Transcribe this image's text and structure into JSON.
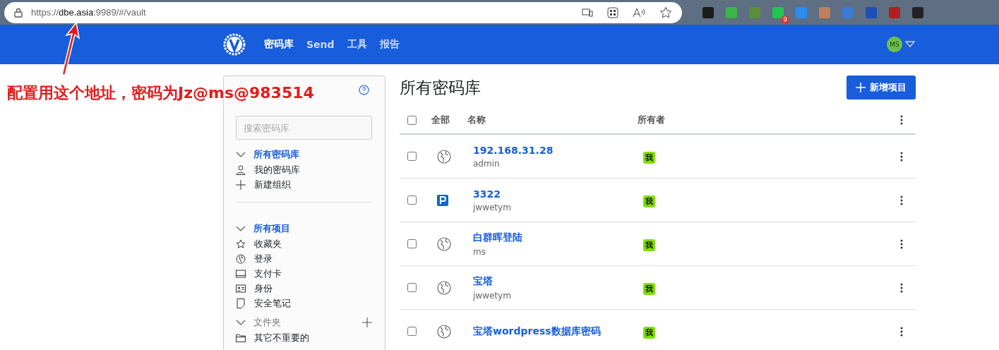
{
  "browser": {
    "url_scheme": "https://",
    "url_host": "dbe.asia",
    "url_rest": ":9989/#/vault",
    "extension_badge": "9"
  },
  "nav": {
    "items": [
      {
        "label": "密码库",
        "selected": true
      },
      {
        "label": "Send",
        "selected": false
      },
      {
        "label": "工具",
        "selected": false
      },
      {
        "label": "报告",
        "selected": false
      }
    ],
    "avatar": "MS"
  },
  "annotation": {
    "text": "配置用这个地址，密码为Jz@ms@983514"
  },
  "sidebar": {
    "search_placeholder": "搜索密码库",
    "sections": [
      {
        "kind": "filter",
        "title": "所有密码库",
        "expanded": true,
        "items": [
          {
            "kind": "user",
            "label": "我的密码库"
          },
          {
            "kind": "plus",
            "label": "新建组织"
          }
        ]
      },
      {
        "kind": "filter",
        "title": "所有项目",
        "expanded": true,
        "items": [
          {
            "kind": "star",
            "label": "收藏夹"
          },
          {
            "kind": "globe",
            "label": "登录"
          },
          {
            "kind": "card",
            "label": "支付卡"
          },
          {
            "kind": "id",
            "label": "身份"
          },
          {
            "kind": "note",
            "label": "安全笔记"
          }
        ]
      },
      {
        "kind": "folders",
        "title": "文件夹",
        "expanded": true,
        "items": [
          {
            "kind": "folder",
            "label": "其它不重要的"
          }
        ]
      }
    ]
  },
  "main": {
    "title": "所有密码库",
    "add_button": "新增项目",
    "columns": [
      "全部",
      "名称",
      "所有者"
    ],
    "select_all_checked": false,
    "rows": [
      {
        "kind": "globe",
        "name": "192.168.31.28",
        "username": "admin",
        "owner": "我",
        "checked": false
      },
      {
        "kind": "p",
        "name": "3322",
        "username": "jwwetym",
        "owner": "我",
        "checked": false
      },
      {
        "kind": "globe",
        "name": "白群晖登陆",
        "username": "ms",
        "owner": "我",
        "checked": false
      },
      {
        "kind": "globe",
        "name": "宝塔",
        "username": "jwwetym",
        "owner": "我",
        "checked": false
      },
      {
        "kind": "globe",
        "name": "宝塔wordpress数据库密码",
        "owner": "我",
        "checked": false
      }
    ]
  }
}
